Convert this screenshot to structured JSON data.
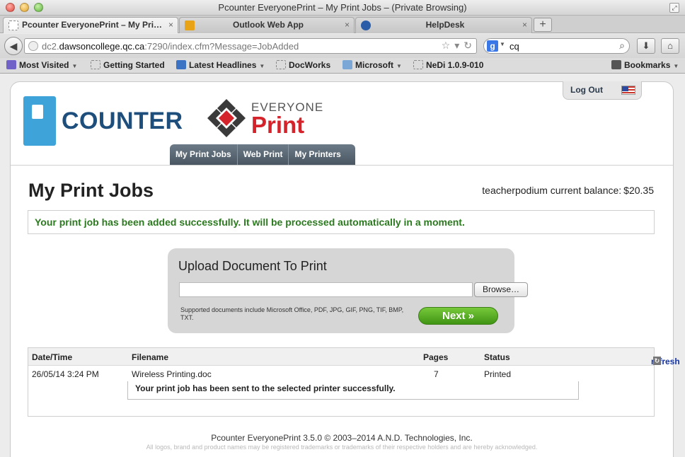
{
  "window": {
    "title": "Pcounter EveryonePrint – My Print Jobs – (Private Browsing)"
  },
  "tabs": [
    {
      "label": "Pcounter EveryonePrint – My Pri…",
      "close": "×"
    },
    {
      "label": "Outlook Web App",
      "close": "×"
    },
    {
      "label": "HelpDesk",
      "close": "×"
    }
  ],
  "new_tab_label": "+",
  "address": {
    "prefix": "dc2.",
    "domain": "dawsoncollege.qc.ca",
    "suffix": ":7290/index.cfm?Message=JobAdded"
  },
  "search": {
    "engine_letter": "g",
    "query": "cq"
  },
  "bookmarks": [
    {
      "label": "Most Visited",
      "dropdown": true,
      "icon": "gear-icon"
    },
    {
      "label": "Getting Started",
      "dropdown": false,
      "icon": "page-icon"
    },
    {
      "label": "Latest Headlines",
      "dropdown": true,
      "icon": "rss-icon"
    },
    {
      "label": "DocWorks",
      "dropdown": false,
      "icon": "page-icon"
    },
    {
      "label": "Microsoft",
      "dropdown": true,
      "icon": "folder-icon"
    },
    {
      "label": "NeDi 1.0.9-010",
      "dropdown": false,
      "icon": "page-icon"
    },
    {
      "label": "Bookmarks",
      "dropdown": true,
      "icon": "star-icon"
    }
  ],
  "brand": {
    "pcounter": "COUNTER",
    "everyone": "EVERYONE",
    "print": "Print",
    "colors": {
      "pcounter_blue": "#3ea3d8",
      "pcounter_navy": "#1d4e7c",
      "print_red": "#d4232b"
    }
  },
  "header": {
    "logout": "Log Out"
  },
  "nav": [
    "My Print Jobs",
    "Web Print",
    "My Printers"
  ],
  "page": {
    "title": "My Print Jobs",
    "balance_label": "teacherpodium current balance:",
    "balance_value": "$20.35",
    "success_message": "Your print job has been added successfully. It will be processed automatically in a moment."
  },
  "upload": {
    "title": "Upload Document To Print",
    "browse": "Browse…",
    "note": "Supported documents include Microsoft Office, PDF, JPG, GIF, PNG, TIF, BMP, TXT.",
    "next": "Next »"
  },
  "jobs": {
    "columns": [
      "Date/Time",
      "Filename",
      "Pages",
      "Status"
    ],
    "refresh": "refresh",
    "rows": [
      {
        "datetime": "26/05/14 3:24 PM",
        "filename": "Wireless Printing.doc",
        "pages": "7",
        "status": "Printed",
        "detail": "Your print job has been sent to the selected printer successfully."
      }
    ]
  },
  "footer": {
    "copyright": "Pcounter EveryonePrint 3.5.0 © 2003–2014 A.N.D. Technologies, Inc.",
    "note": "All logos, brand and product names may be registered trademarks or trademarks of their respective holders and are hereby acknowledged."
  }
}
